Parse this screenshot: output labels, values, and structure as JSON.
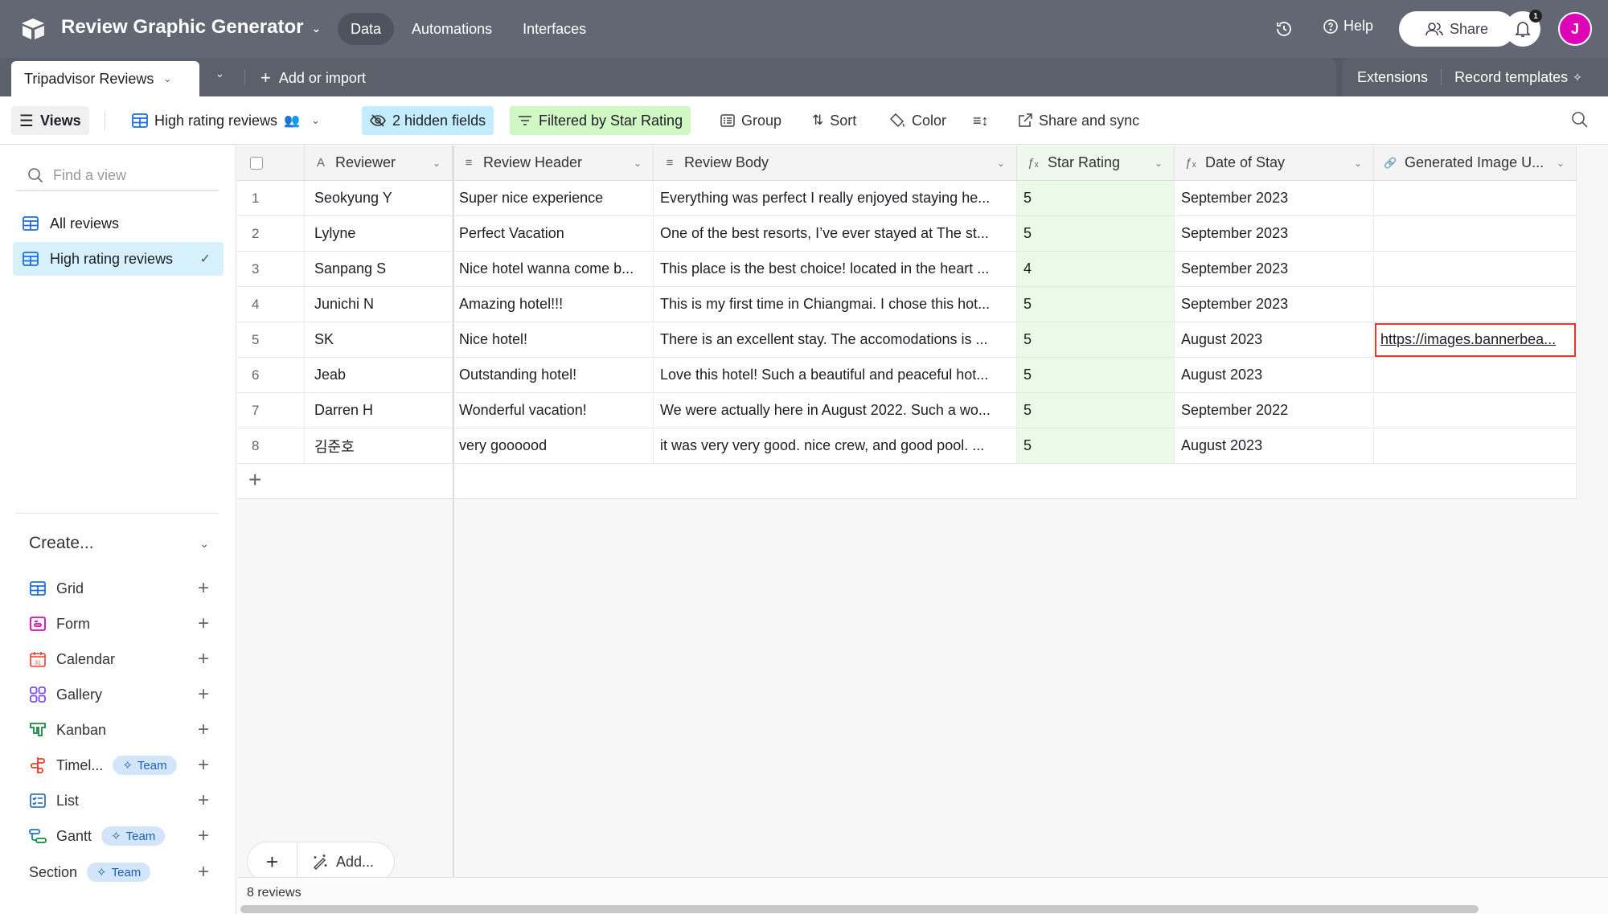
{
  "app": {
    "title": "Review Graphic Generator",
    "nav": [
      "Data",
      "Automations",
      "Interfaces"
    ],
    "active_nav": "Data",
    "help": "Help",
    "share": "Share",
    "notifications": "1",
    "avatar_initial": "J",
    "avatar_color": "#dd04b6"
  },
  "tables": {
    "active_table": "Tripadvisor Reviews",
    "add_or_import": "Add or import",
    "extensions": "Extensions",
    "record_templates": "Record templates"
  },
  "viewbar": {
    "views": "Views",
    "current_view": "High rating reviews",
    "hidden_fields": "2 hidden fields",
    "filter": "Filtered by Star Rating",
    "group": "Group",
    "sort": "Sort",
    "color": "Color",
    "share_sync": "Share and sync"
  },
  "sidebar": {
    "find_placeholder": "Find a view",
    "views": [
      {
        "label": "All reviews",
        "active": false
      },
      {
        "label": "High rating reviews",
        "active": true
      }
    ],
    "create_label": "Create...",
    "create_items": [
      {
        "label": "Grid",
        "icon": "grid-icon",
        "color": "#1d6fe0",
        "badge": ""
      },
      {
        "label": "Form",
        "icon": "form-icon",
        "color": "#dd04b6",
        "badge": ""
      },
      {
        "label": "Calendar",
        "icon": "calendar-icon",
        "color": "#e8402c",
        "badge": ""
      },
      {
        "label": "Gallery",
        "icon": "gallery-icon",
        "color": "#7c4dff",
        "badge": ""
      },
      {
        "label": "Kanban",
        "icon": "kanban-icon",
        "color": "#168a3e",
        "badge": ""
      },
      {
        "label": "Timel...",
        "icon": "timeline-icon",
        "color": "#e8402c",
        "badge": "Team"
      },
      {
        "label": "List",
        "icon": "list-icon",
        "color": "#1d5fb8",
        "badge": ""
      },
      {
        "label": "Gantt",
        "icon": "gantt-icon",
        "color": "#168a6e",
        "badge": "Team"
      },
      {
        "label": "Section",
        "icon": "",
        "color": "",
        "badge": "Team"
      }
    ]
  },
  "grid": {
    "columns": [
      {
        "label": "Reviewer",
        "icon": "text-a-icon"
      },
      {
        "label": "Review Header",
        "icon": "long-text-icon"
      },
      {
        "label": "Review Body",
        "icon": "long-text-icon"
      },
      {
        "label": "Star Rating",
        "icon": "formula-icon"
      },
      {
        "label": "Date of Stay",
        "icon": "formula-icon"
      },
      {
        "label": "Generated Image U...",
        "icon": "link-icon"
      }
    ],
    "rows": [
      {
        "n": "1",
        "reviewer": "Seokyung Y",
        "header": "Super nice experience",
        "body": "Everything was perfect I really enjoyed staying he...",
        "rating": "5",
        "date": "September 2023",
        "url": ""
      },
      {
        "n": "2",
        "reviewer": "Lylyne",
        "header": "Perfect Vacation",
        "body": "One of the best resorts, I’ve ever stayed at The st...",
        "rating": "5",
        "date": "September 2023",
        "url": ""
      },
      {
        "n": "3",
        "reviewer": "Sanpang S",
        "header": "Nice hotel wanna come b...",
        "body": "This place is the best choice! located in the heart ...",
        "rating": "4",
        "date": "September 2023",
        "url": ""
      },
      {
        "n": "4",
        "reviewer": "Junichi N",
        "header": "Amazing hotel!!!",
        "body": "This is my first time in Chiangmai. I chose this hot...",
        "rating": "5",
        "date": "September 2023",
        "url": ""
      },
      {
        "n": "5",
        "reviewer": "SK",
        "header": "Nice hotel!",
        "body": "There is an excellent stay. The accomodations is ...",
        "rating": "5",
        "date": "August 2023",
        "url": "https://images.bannerbea..."
      },
      {
        "n": "6",
        "reviewer": "Jeab",
        "header": "Outstanding hotel!",
        "body": "Love this hotel! Such a beautiful and peaceful hot...",
        "rating": "5",
        "date": "August 2023",
        "url": ""
      },
      {
        "n": "7",
        "reviewer": "Darren H",
        "header": "Wonderful vacation!",
        "body": "We were actually here in August 2022. Such a wo...",
        "rating": "5",
        "date": "September 2022",
        "url": ""
      },
      {
        "n": "8",
        "reviewer": "김준호",
        "header": "very goooood",
        "body": "it was very very good. nice crew, and good pool. ...",
        "rating": "5",
        "date": "August 2023",
        "url": ""
      }
    ],
    "add_label": "Add...",
    "record_count": "8 reviews"
  }
}
